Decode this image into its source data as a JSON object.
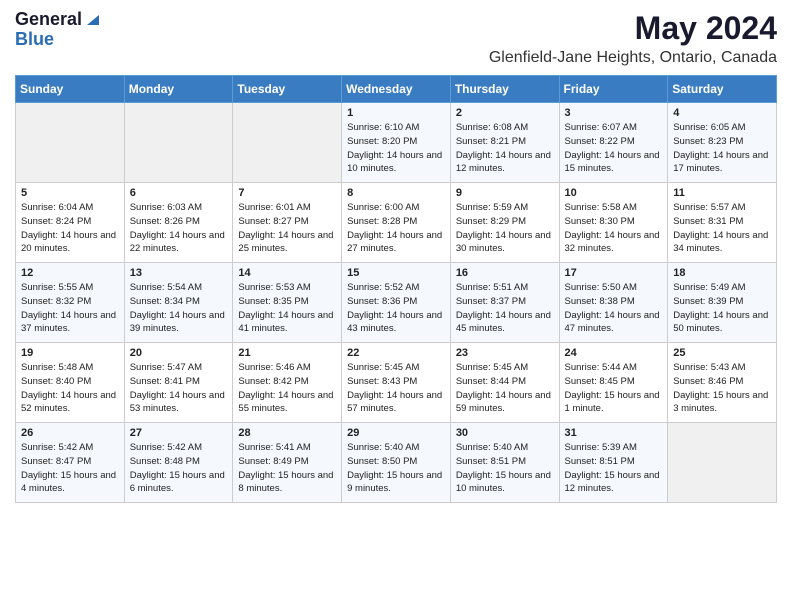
{
  "logo": {
    "general": "General",
    "blue": "Blue"
  },
  "title": {
    "month": "May 2024",
    "location": "Glenfield-Jane Heights, Ontario, Canada"
  },
  "header_days": [
    "Sunday",
    "Monday",
    "Tuesday",
    "Wednesday",
    "Thursday",
    "Friday",
    "Saturday"
  ],
  "weeks": [
    [
      {
        "day": "",
        "sunrise": "",
        "sunset": "",
        "daylight": ""
      },
      {
        "day": "",
        "sunrise": "",
        "sunset": "",
        "daylight": ""
      },
      {
        "day": "",
        "sunrise": "",
        "sunset": "",
        "daylight": ""
      },
      {
        "day": "1",
        "sunrise": "Sunrise: 6:10 AM",
        "sunset": "Sunset: 8:20 PM",
        "daylight": "Daylight: 14 hours and 10 minutes."
      },
      {
        "day": "2",
        "sunrise": "Sunrise: 6:08 AM",
        "sunset": "Sunset: 8:21 PM",
        "daylight": "Daylight: 14 hours and 12 minutes."
      },
      {
        "day": "3",
        "sunrise": "Sunrise: 6:07 AM",
        "sunset": "Sunset: 8:22 PM",
        "daylight": "Daylight: 14 hours and 15 minutes."
      },
      {
        "day": "4",
        "sunrise": "Sunrise: 6:05 AM",
        "sunset": "Sunset: 8:23 PM",
        "daylight": "Daylight: 14 hours and 17 minutes."
      }
    ],
    [
      {
        "day": "5",
        "sunrise": "Sunrise: 6:04 AM",
        "sunset": "Sunset: 8:24 PM",
        "daylight": "Daylight: 14 hours and 20 minutes."
      },
      {
        "day": "6",
        "sunrise": "Sunrise: 6:03 AM",
        "sunset": "Sunset: 8:26 PM",
        "daylight": "Daylight: 14 hours and 22 minutes."
      },
      {
        "day": "7",
        "sunrise": "Sunrise: 6:01 AM",
        "sunset": "Sunset: 8:27 PM",
        "daylight": "Daylight: 14 hours and 25 minutes."
      },
      {
        "day": "8",
        "sunrise": "Sunrise: 6:00 AM",
        "sunset": "Sunset: 8:28 PM",
        "daylight": "Daylight: 14 hours and 27 minutes."
      },
      {
        "day": "9",
        "sunrise": "Sunrise: 5:59 AM",
        "sunset": "Sunset: 8:29 PM",
        "daylight": "Daylight: 14 hours and 30 minutes."
      },
      {
        "day": "10",
        "sunrise": "Sunrise: 5:58 AM",
        "sunset": "Sunset: 8:30 PM",
        "daylight": "Daylight: 14 hours and 32 minutes."
      },
      {
        "day": "11",
        "sunrise": "Sunrise: 5:57 AM",
        "sunset": "Sunset: 8:31 PM",
        "daylight": "Daylight: 14 hours and 34 minutes."
      }
    ],
    [
      {
        "day": "12",
        "sunrise": "Sunrise: 5:55 AM",
        "sunset": "Sunset: 8:32 PM",
        "daylight": "Daylight: 14 hours and 37 minutes."
      },
      {
        "day": "13",
        "sunrise": "Sunrise: 5:54 AM",
        "sunset": "Sunset: 8:34 PM",
        "daylight": "Daylight: 14 hours and 39 minutes."
      },
      {
        "day": "14",
        "sunrise": "Sunrise: 5:53 AM",
        "sunset": "Sunset: 8:35 PM",
        "daylight": "Daylight: 14 hours and 41 minutes."
      },
      {
        "day": "15",
        "sunrise": "Sunrise: 5:52 AM",
        "sunset": "Sunset: 8:36 PM",
        "daylight": "Daylight: 14 hours and 43 minutes."
      },
      {
        "day": "16",
        "sunrise": "Sunrise: 5:51 AM",
        "sunset": "Sunset: 8:37 PM",
        "daylight": "Daylight: 14 hours and 45 minutes."
      },
      {
        "day": "17",
        "sunrise": "Sunrise: 5:50 AM",
        "sunset": "Sunset: 8:38 PM",
        "daylight": "Daylight: 14 hours and 47 minutes."
      },
      {
        "day": "18",
        "sunrise": "Sunrise: 5:49 AM",
        "sunset": "Sunset: 8:39 PM",
        "daylight": "Daylight: 14 hours and 50 minutes."
      }
    ],
    [
      {
        "day": "19",
        "sunrise": "Sunrise: 5:48 AM",
        "sunset": "Sunset: 8:40 PM",
        "daylight": "Daylight: 14 hours and 52 minutes."
      },
      {
        "day": "20",
        "sunrise": "Sunrise: 5:47 AM",
        "sunset": "Sunset: 8:41 PM",
        "daylight": "Daylight: 14 hours and 53 minutes."
      },
      {
        "day": "21",
        "sunrise": "Sunrise: 5:46 AM",
        "sunset": "Sunset: 8:42 PM",
        "daylight": "Daylight: 14 hours and 55 minutes."
      },
      {
        "day": "22",
        "sunrise": "Sunrise: 5:45 AM",
        "sunset": "Sunset: 8:43 PM",
        "daylight": "Daylight: 14 hours and 57 minutes."
      },
      {
        "day": "23",
        "sunrise": "Sunrise: 5:45 AM",
        "sunset": "Sunset: 8:44 PM",
        "daylight": "Daylight: 14 hours and 59 minutes."
      },
      {
        "day": "24",
        "sunrise": "Sunrise: 5:44 AM",
        "sunset": "Sunset: 8:45 PM",
        "daylight": "Daylight: 15 hours and 1 minute."
      },
      {
        "day": "25",
        "sunrise": "Sunrise: 5:43 AM",
        "sunset": "Sunset: 8:46 PM",
        "daylight": "Daylight: 15 hours and 3 minutes."
      }
    ],
    [
      {
        "day": "26",
        "sunrise": "Sunrise: 5:42 AM",
        "sunset": "Sunset: 8:47 PM",
        "daylight": "Daylight: 15 hours and 4 minutes."
      },
      {
        "day": "27",
        "sunrise": "Sunrise: 5:42 AM",
        "sunset": "Sunset: 8:48 PM",
        "daylight": "Daylight: 15 hours and 6 minutes."
      },
      {
        "day": "28",
        "sunrise": "Sunrise: 5:41 AM",
        "sunset": "Sunset: 8:49 PM",
        "daylight": "Daylight: 15 hours and 8 minutes."
      },
      {
        "day": "29",
        "sunrise": "Sunrise: 5:40 AM",
        "sunset": "Sunset: 8:50 PM",
        "daylight": "Daylight: 15 hours and 9 minutes."
      },
      {
        "day": "30",
        "sunrise": "Sunrise: 5:40 AM",
        "sunset": "Sunset: 8:51 PM",
        "daylight": "Daylight: 15 hours and 10 minutes."
      },
      {
        "day": "31",
        "sunrise": "Sunrise: 5:39 AM",
        "sunset": "Sunset: 8:51 PM",
        "daylight": "Daylight: 15 hours and 12 minutes."
      },
      {
        "day": "",
        "sunrise": "",
        "sunset": "",
        "daylight": ""
      }
    ]
  ]
}
